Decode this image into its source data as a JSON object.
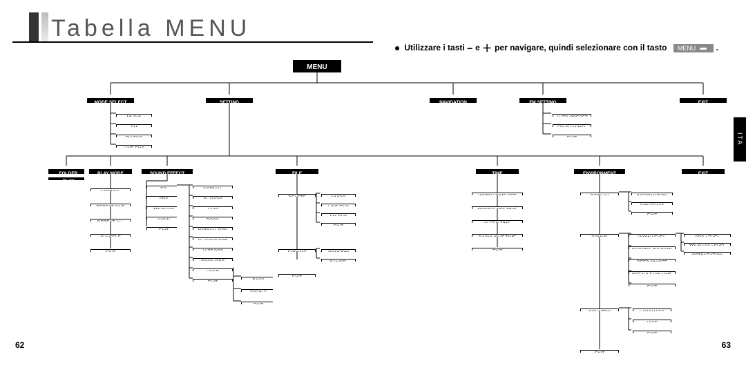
{
  "doc": {
    "title": "Tabella MENU",
    "instruction_prefix": "Utilizzare i tasti",
    "instruction_mid": "e",
    "instruction_suffix": "per navigare, quindi selezionare con il tasto",
    "menu_button": "MENU",
    "page_left": "62",
    "page_right": "63",
    "lang_tab": "ITA"
  },
  "tree": {
    "root": "MENU",
    "level1": [
      "MODE SELECT",
      "SETTING",
      "NAVIGATION",
      "FM SETTING",
      "EXIT"
    ],
    "mode_select": [
      "MUSIC",
      "FM",
      "FM ENC",
      "LINE ENC"
    ],
    "fm_setting": [
      "AUTO PRESET",
      "FM CHANNEL",
      "EXIT"
    ],
    "setting_children": [
      "FOLDER PLAY",
      "PLAY MODE",
      "SOUND EFFECT",
      "FILE",
      "TIME",
      "ENVIRONMENT",
      "EXIT"
    ],
    "play_mode": [
      "NORMAL",
      "REPEAT ONE",
      "REPEAT ALL",
      "SHUFFLE",
      "EXIT"
    ],
    "sound_effect_col1": [
      "EQ",
      "SRS",
      "TRUBASS",
      "WOW",
      "EXIT"
    ],
    "eq_children": [
      "NORMAL",
      "CLASSIC",
      "JAZZ",
      "ROCK",
      "NORMAL DBB",
      "CLASSIC DBB",
      "JAZZ DBB",
      "ROCK DBB",
      "USER",
      "EXIT"
    ],
    "user_children": [
      "BASS",
      "TREBLE",
      "EXIT"
    ],
    "file_children": [
      "DELETE",
      "FORMAT",
      "EXIT"
    ],
    "delete_children": [
      "MUSIC",
      "LINE ENC",
      "FM ENC",
      "EXIT"
    ],
    "format_children": [
      "CONFIRM",
      "CANCEL"
    ],
    "time_children": [
      "WATCH TIME SET",
      "POWER OFF TIME",
      "SLEEP TIME",
      "BACKLIGHT TIME",
      "EXIT"
    ],
    "environment_children": [
      "DISPLAY",
      "SOUND",
      "COUNTRY",
      "EXIT"
    ],
    "display_children": [
      "INFORMATION",
      "CONTRAST",
      "EXIT"
    ],
    "sound_children": [
      "WOW LEVEL",
      "ENCODE BIT RATE",
      "BEEP ON/OFF",
      "DEFAULT VOLUME",
      "EXIT"
    ],
    "wow_children": [
      "SRS LEVEL",
      "TRUBASS LEVEL",
      "OPTIMIZATION"
    ],
    "country_children": [
      "LANGUAGE",
      "UNIT",
      "EXIT"
    ]
  }
}
